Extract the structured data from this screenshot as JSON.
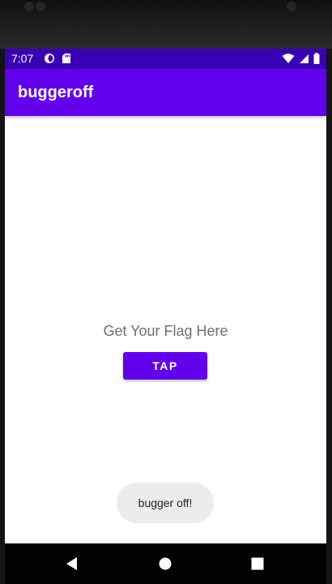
{
  "status_bar": {
    "time": "7:07",
    "left_icons": [
      "data-saver-icon",
      "sd-card-icon"
    ],
    "right_icons": [
      "wifi-icon",
      "cell-signal-icon",
      "battery-icon"
    ]
  },
  "app_bar": {
    "title": "buggeroff"
  },
  "main": {
    "prompt": "Get Your Flag Here",
    "tap_button_label": "TAP"
  },
  "toast": {
    "message": "bugger off!"
  },
  "nav_bar": {
    "buttons": [
      "back-icon",
      "home-icon",
      "recents-icon"
    ]
  },
  "colors": {
    "status_bar": "#3700b3",
    "primary": "#6200ee",
    "prompt_text": "#707070",
    "toast_bg": "#ececec"
  }
}
